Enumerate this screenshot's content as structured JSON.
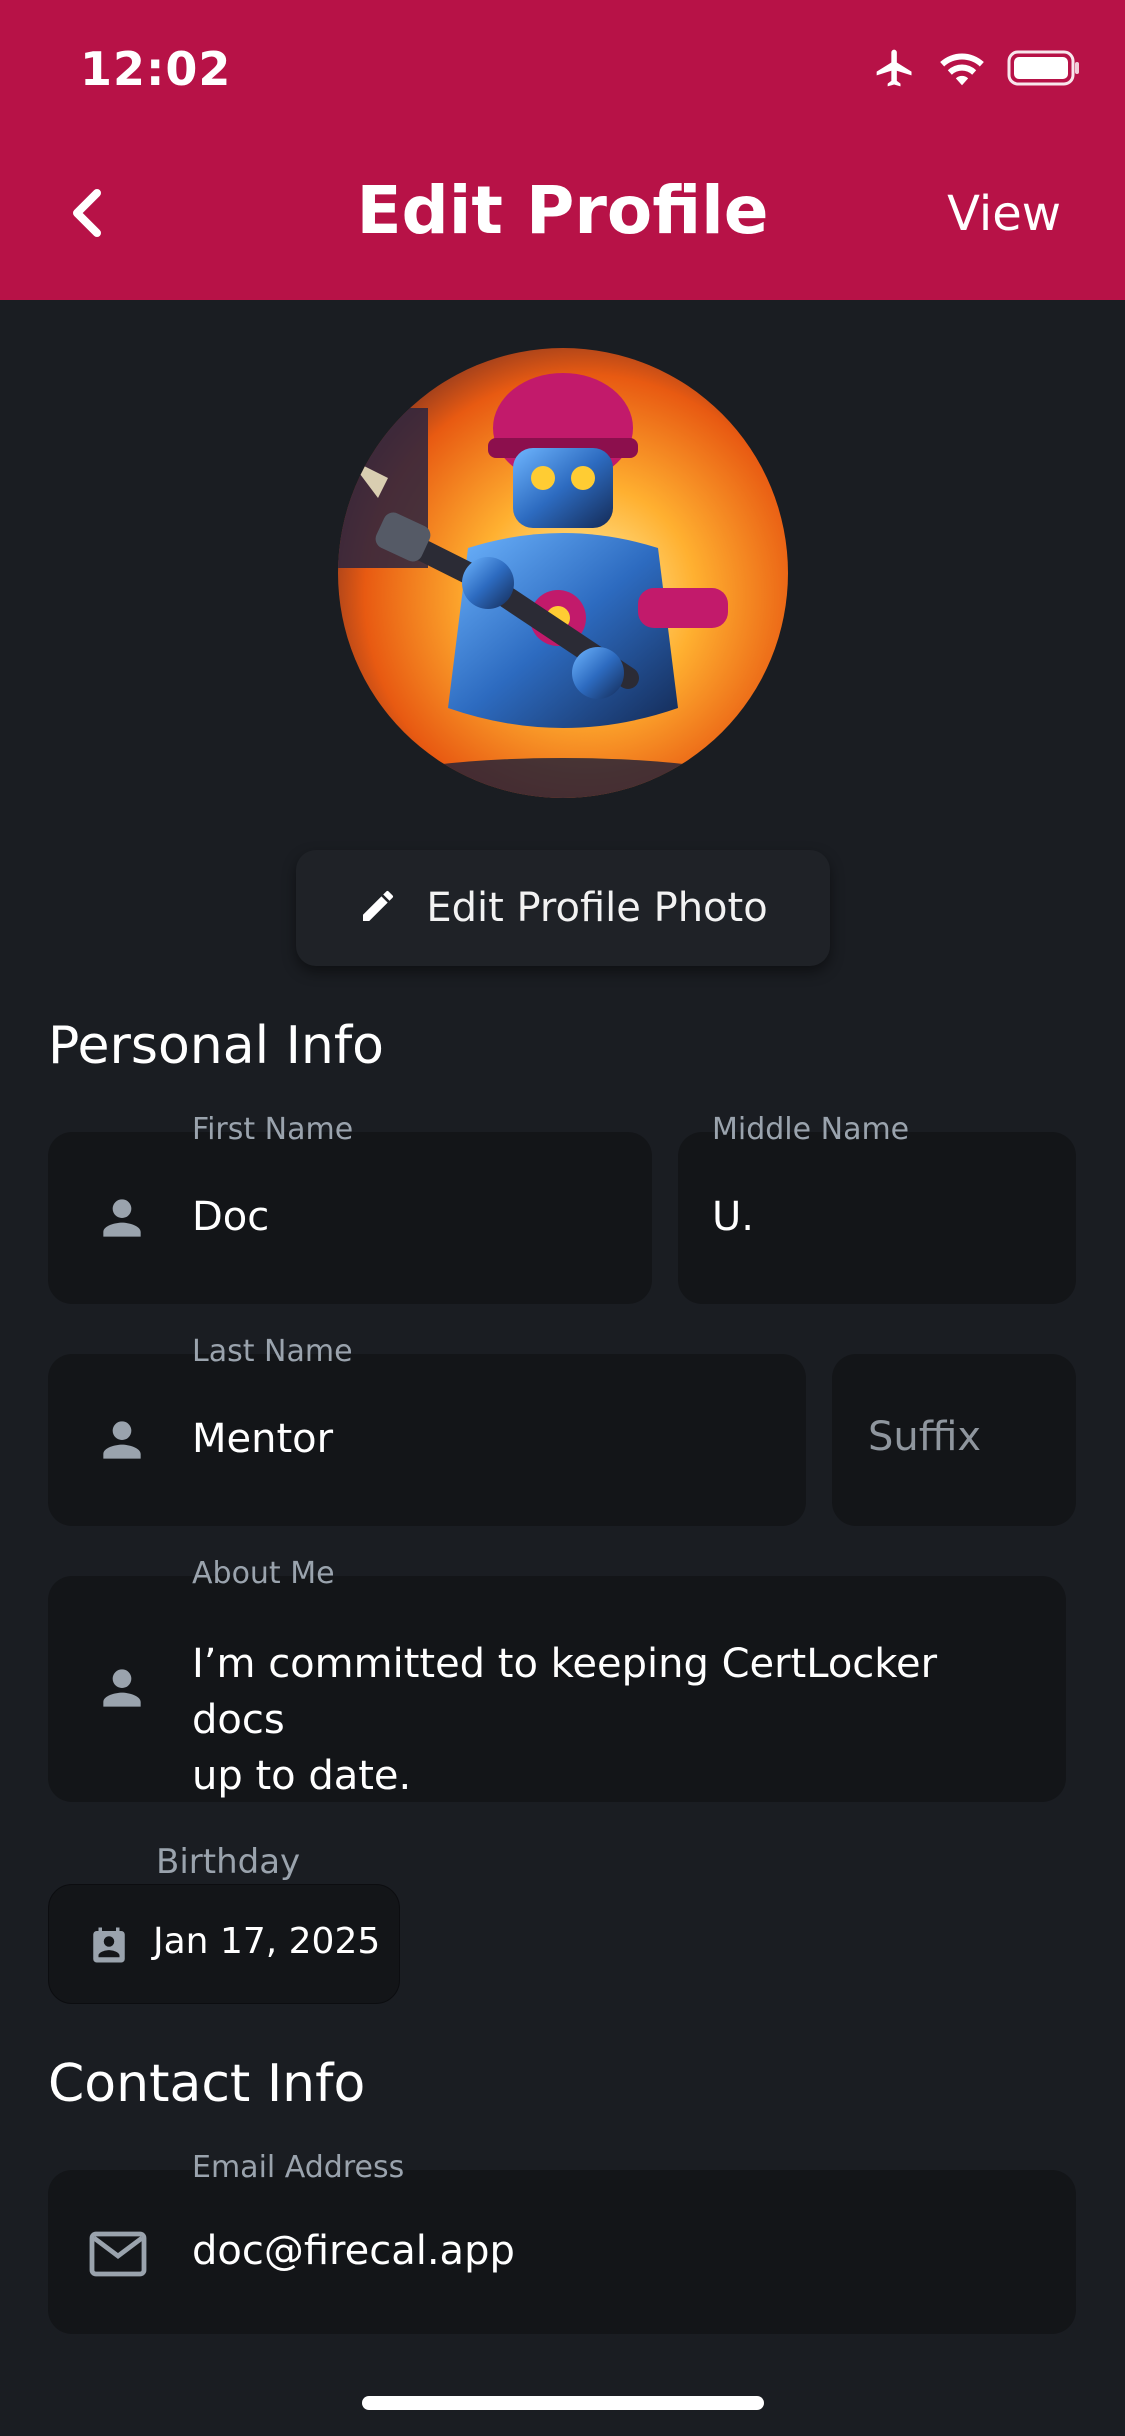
{
  "status_bar": {
    "time": "12:02"
  },
  "header": {
    "title": "Edit Profile",
    "view_label": "View"
  },
  "edit_photo": {
    "label": "Edit Profile Photo"
  },
  "sections": {
    "personal": "Personal Info",
    "contact": "Contact Info"
  },
  "fields": {
    "first_name": {
      "label": "First Name",
      "value": "Doc"
    },
    "middle_name": {
      "label": "Middle Name",
      "value": "U."
    },
    "last_name": {
      "label": "Last Name",
      "value": "Mentor"
    },
    "suffix": {
      "placeholder": "Suffix"
    },
    "about_me": {
      "label": "About Me",
      "line1": "I’m committed to keeping CertLocker docs",
      "line2": "up to date."
    },
    "birthday": {
      "label": "Birthday",
      "value": "Jan 17, 2025"
    },
    "email": {
      "label": "Email Address",
      "value": "doc@firecal.app"
    }
  },
  "colors": {
    "header": "#b71247",
    "background": "#1a1d22",
    "field": "#131518",
    "label": "#9aa3ad"
  },
  "icons": [
    "airplane-icon",
    "wifi-icon",
    "battery-icon",
    "chevron-left-icon",
    "pencil-icon",
    "person-icon",
    "calendar-person-icon",
    "mail-icon"
  ]
}
